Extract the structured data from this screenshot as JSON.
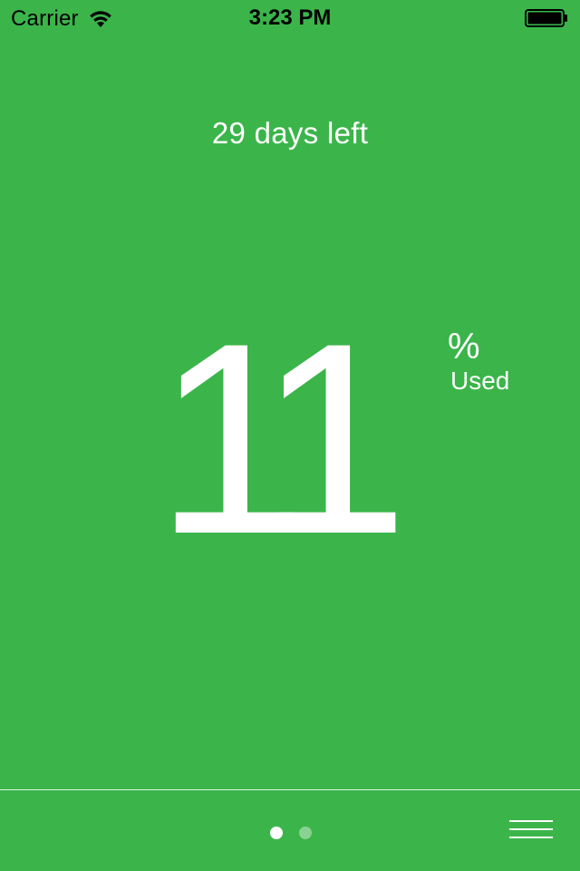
{
  "status_bar": {
    "carrier": "Carrier",
    "time": "3:23 PM",
    "wifi_icon": "wifi-icon",
    "battery_icon": "battery-icon"
  },
  "usage": {
    "days_left": "29 days left",
    "percent_used": "11",
    "percent_sign": "%",
    "used_label": "Used"
  },
  "pager": {
    "pages": 2,
    "current": 1
  },
  "menu": {
    "icon": "hamburger-menu-icon"
  },
  "colors": {
    "background": "#3bb54a",
    "foreground": "#ffffff"
  }
}
